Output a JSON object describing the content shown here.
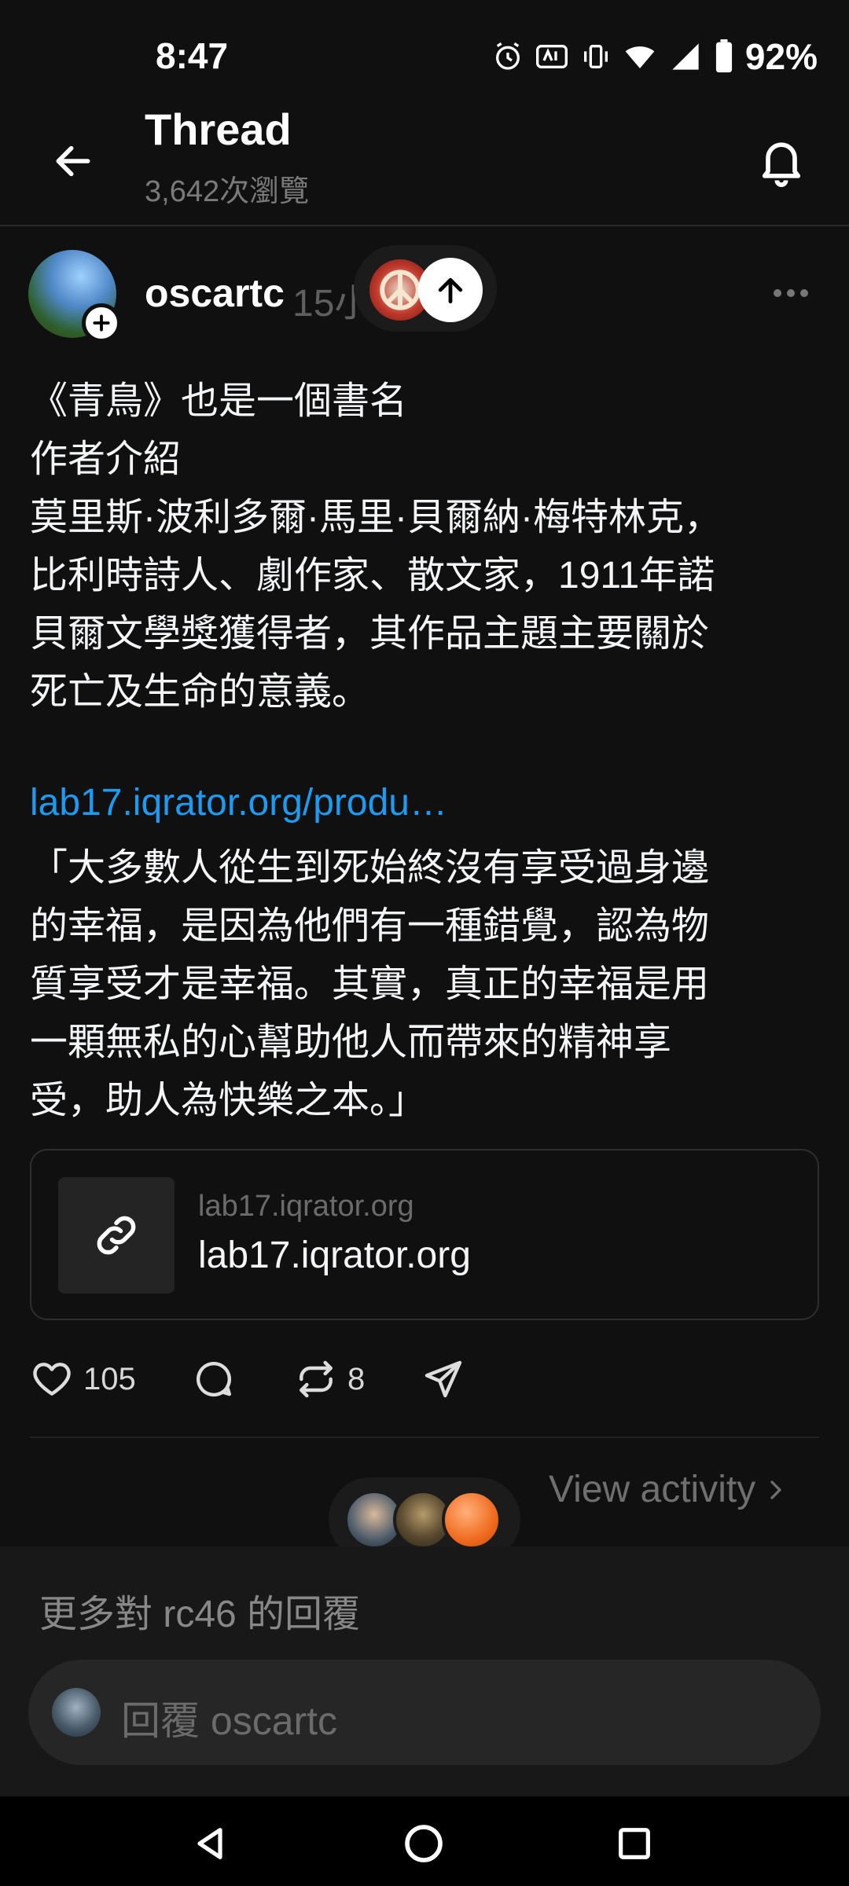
{
  "status_bar": {
    "time": "8:47",
    "battery": "92%",
    "icons": [
      "alarm-icon",
      "auto-hz-icon",
      "vibrate-icon",
      "wifi-icon",
      "signal-icon",
      "battery-icon"
    ]
  },
  "header": {
    "title": "Thread",
    "views": "3,642次瀏覽",
    "back_icon": "back-arrow-icon",
    "bell_icon": "bell-icon"
  },
  "post": {
    "username": "oscartc",
    "timestamp": "15小時",
    "body_lines": [
      "《青鳥》也是一個書名",
      "作者介紹",
      "莫里斯·波利多爾·馬里·貝爾納·梅特林克，",
      "比利時詩人、劇作家、散文家，1911年諾",
      "貝爾文學獎獲得者，其作品主題主要關於",
      "死亡及生命的意義。"
    ],
    "link_text": "lab17.iqrator.org/produ…",
    "quote_lines": [
      "「大多數人從生到死始終沒有享受過身邊",
      "的幸福，是因為他們有一種錯覺，認為物",
      "質享受才是幸福。其實，真正的幸福是用",
      "一顆無私的心幫助他人而帶來的精神享",
      "受，助人為快樂之本。」"
    ],
    "link_card": {
      "domain": "lab17.iqrator.org",
      "title": "lab17.iqrator.org"
    },
    "actions": {
      "likes": "105",
      "reposts": "8"
    }
  },
  "activity": {
    "label": "View activity"
  },
  "replies": {
    "more_label": "更多對 rc46 的回覆",
    "reply_placeholder": "回覆 oscartc"
  },
  "colors": {
    "background": "#101010",
    "link": "#1d9bf0",
    "muted": "#6f6f6f"
  }
}
